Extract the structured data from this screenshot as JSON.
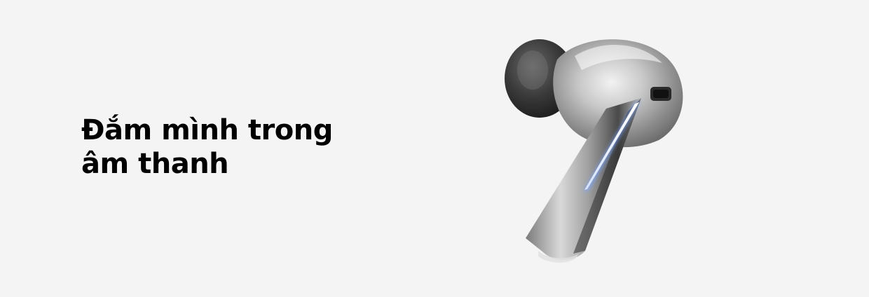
{
  "hero": {
    "headline_line1": "Đắm mình trong",
    "headline_line2": "âm thanh",
    "image": "silver-wireless-earbud",
    "colors": {
      "background": "#f4f4f4",
      "text": "#000000",
      "accent_light": "#7aa6ff"
    }
  }
}
